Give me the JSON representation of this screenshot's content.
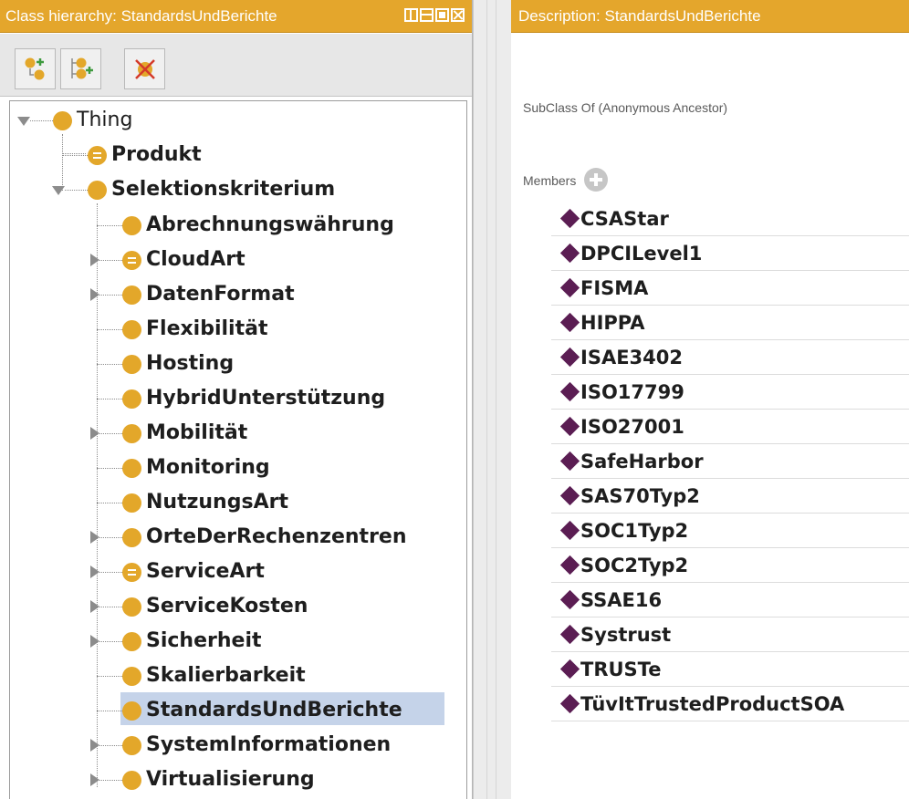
{
  "class_hierarchy": {
    "header": "Class hierarchy: StandardsUndBerichte",
    "toolbar": {
      "add_subclass_icon": "add-subclass-icon",
      "add_sibling_icon": "add-sibling-class-icon",
      "delete_icon": "delete-class-icon"
    },
    "tree": {
      "root": "Thing",
      "produkt": "Produkt",
      "selektionskriterium": "Selektionskriterium",
      "children": [
        "Abrechnungswährung",
        "CloudArt",
        "DatenFormat",
        "Flexibilität",
        "Hosting",
        "HybridUnterstützung",
        "Mobilität",
        "Monitoring",
        "NutzungsArt",
        "OrteDerRechenzentren",
        "ServiceArt",
        "ServiceKosten",
        "Sicherheit",
        "Skalierbarkeit",
        "StandardsUndBerichte",
        "SystemInformationen",
        "Virtualisierung"
      ],
      "selected": "StandardsUndBerichte"
    }
  },
  "description": {
    "header": "Description: StandardsUndBerichte",
    "subclass_of_label": "SubClass Of (Anonymous Ancestor)",
    "members_label": "Members",
    "members": [
      "CSAStar",
      "DPCILevel1",
      "FISMA",
      "HIPPA",
      "ISAE3402",
      "ISO17799",
      "ISO27001",
      "SafeHarbor",
      "SAS70Typ2",
      "SOC1Typ2",
      "SOC2Typ2",
      "SSAE16",
      "Systrust",
      "TRUSTe",
      "TüvItTrustedProductSOA"
    ]
  },
  "colors": {
    "header_bg": "#e4a62c",
    "class_icon": "#e3a72a",
    "individual_icon": "#5b1d53",
    "selection_bg": "#c5d3e9"
  }
}
